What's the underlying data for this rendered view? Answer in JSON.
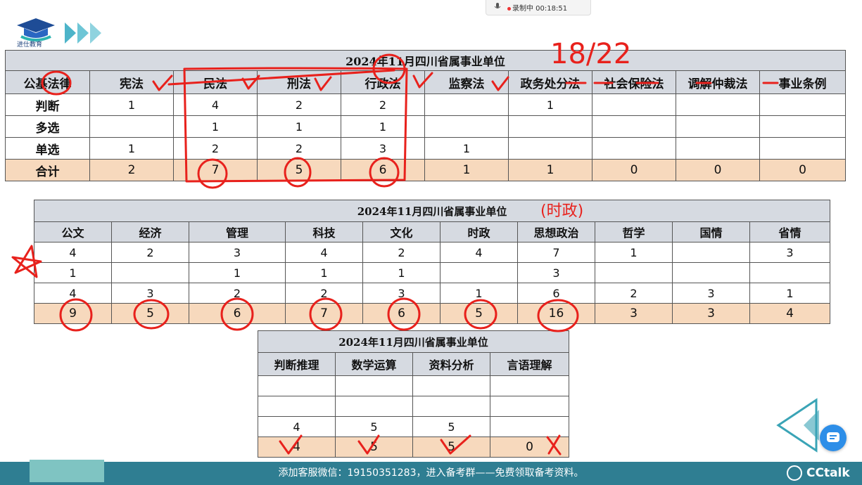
{
  "recording": {
    "mic_icon": "mic-icon",
    "status": "录制中 00:18:51"
  },
  "logo": {
    "text": "进仕教育",
    "icon": "graduation-cap-icon"
  },
  "table1": {
    "title": "2024年11月四川省属事业单位",
    "headers": [
      "公基法律",
      "宪法",
      "民法",
      "刑法",
      "行政法",
      "监察法",
      "政务处分法",
      "社会保险法",
      "调解仲裁法",
      "事业条例"
    ],
    "rows": [
      [
        "判断",
        "1",
        "4",
        "2",
        "2",
        "",
        "1",
        "",
        "",
        ""
      ],
      [
        "多选",
        "",
        "1",
        "1",
        "1",
        "",
        "",
        "",
        "",
        ""
      ],
      [
        "单选",
        "1",
        "2",
        "2",
        "3",
        "1",
        "",
        "",
        "",
        ""
      ]
    ],
    "total": [
      "合计",
      "2",
      "7",
      "5",
      "6",
      "1",
      "1",
      "0",
      "0",
      "0"
    ]
  },
  "table2": {
    "title": "2024年11月四川省属事业单位",
    "headers": [
      "公文",
      "经济",
      "管理",
      "科技",
      "文化",
      "时政",
      "思想政治",
      "哲学",
      "国情",
      "省情"
    ],
    "rows": [
      [
        "4",
        "2",
        "3",
        "4",
        "2",
        "4",
        "7",
        "1",
        "",
        "3"
      ],
      [
        "1",
        "",
        "1",
        "1",
        "1",
        "",
        "3",
        "",
        "",
        ""
      ],
      [
        "4",
        "3",
        "2",
        "2",
        "3",
        "1",
        "6",
        "2",
        "3",
        "1"
      ]
    ],
    "total": [
      "9",
      "5",
      "6",
      "7",
      "6",
      "5",
      "16",
      "3",
      "3",
      "4"
    ]
  },
  "table3": {
    "title": "2024年11月四川省属事业单位",
    "headers": [
      "判断推理",
      "数学运算",
      "资料分析",
      "言语理解"
    ],
    "rows": [
      [
        "",
        "",
        "",
        ""
      ],
      [
        "",
        "",
        "",
        ""
      ],
      [
        "4",
        "5",
        "5",
        ""
      ]
    ],
    "total": [
      "4",
      "5",
      "5",
      "0"
    ]
  },
  "annotations": {
    "ratio": "18/22",
    "note": "(时政)"
  },
  "footer": {
    "text": "添加客服微信：19150351283，进入备考群——免费领取备考资料。",
    "brand": "CCtalk"
  },
  "colors": {
    "header_bg": "#d6dae1",
    "total_bg": "#f7d9bd",
    "footer_bg": "#2f7e92",
    "ink": "#e8211c"
  }
}
